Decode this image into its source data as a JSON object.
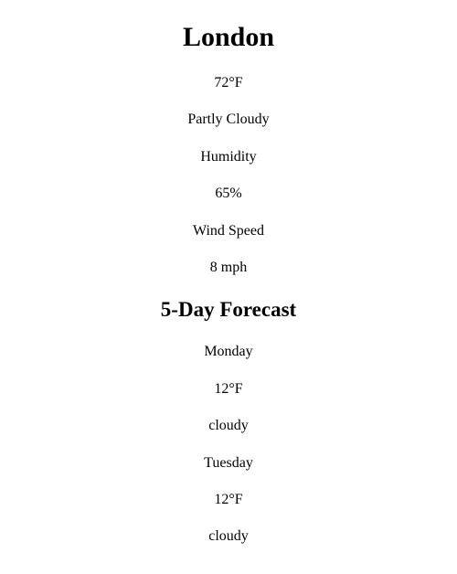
{
  "city": "London",
  "current": {
    "temperature": "72°F",
    "condition": "Partly Cloudy",
    "humidity_label": "Humidity",
    "humidity_value": "65%",
    "wind_label": "Wind Speed",
    "wind_value": "8 mph"
  },
  "forecast_heading": "5-Day Forecast",
  "forecast": [
    {
      "day": "Monday",
      "temp": "12°F",
      "condition": "cloudy"
    },
    {
      "day": "Tuesday",
      "temp": "12°F",
      "condition": "cloudy"
    }
  ]
}
